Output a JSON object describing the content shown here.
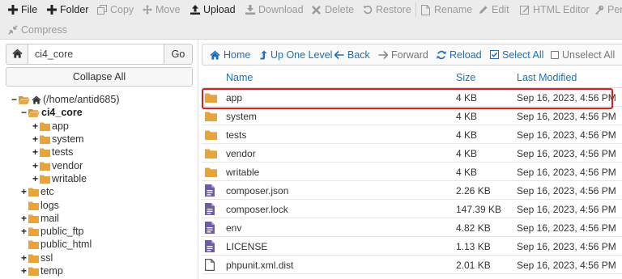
{
  "toolbar": {
    "row1": [
      {
        "label": "File",
        "icon": "plus-icon",
        "enabled": true
      },
      {
        "label": "Folder",
        "icon": "plus-icon",
        "enabled": true
      },
      {
        "label": "Copy",
        "icon": "copy-icon",
        "enabled": false
      },
      {
        "label": "Move",
        "icon": "move-icon",
        "enabled": false
      },
      {
        "label": "Upload",
        "icon": "upload-icon",
        "enabled": true
      },
      {
        "label": "Download",
        "icon": "download-icon",
        "enabled": false
      },
      {
        "label": "Delete",
        "icon": "delete-icon",
        "enabled": false
      },
      {
        "label": "Restore",
        "icon": "restore-icon",
        "enabled": false
      },
      {
        "label": "Rename",
        "icon": "rename-icon",
        "enabled": false
      },
      {
        "label": "Edit",
        "icon": "pencil-icon",
        "enabled": false
      },
      {
        "label": "HTML Editor",
        "icon": "html-editor-icon",
        "enabled": false
      },
      {
        "label": "Perr",
        "icon": "key-icon",
        "enabled": false
      }
    ],
    "compress_label": "Compress"
  },
  "left_panel": {
    "path_value": "ci4_core",
    "go_label": "Go",
    "collapse_label": "Collapse All",
    "tree": [
      {
        "label": "(/home/antid685)",
        "toggle": "−",
        "open": true,
        "home": true,
        "bold": false
      },
      {
        "label": "ci4_core",
        "toggle": "−",
        "open": true,
        "bold": true
      },
      {
        "label": "app",
        "toggle": "+",
        "bold": false
      },
      {
        "label": "system",
        "toggle": "+",
        "bold": false
      },
      {
        "label": "tests",
        "toggle": "+",
        "bold": false
      },
      {
        "label": "vendor",
        "toggle": "+",
        "bold": false
      },
      {
        "label": "writable",
        "toggle": "+",
        "bold": false
      },
      {
        "label": "etc",
        "toggle": "+",
        "bold": false
      },
      {
        "label": "logs",
        "toggle": "",
        "bold": false
      },
      {
        "label": "mail",
        "toggle": "+",
        "bold": false
      },
      {
        "label": "public_ftp",
        "toggle": "+",
        "bold": false
      },
      {
        "label": "public_html",
        "toggle": "",
        "bold": false
      },
      {
        "label": "ssl",
        "toggle": "+",
        "bold": false
      },
      {
        "label": "temp",
        "toggle": "+",
        "bold": false
      }
    ]
  },
  "nav": {
    "home": "Home",
    "up": "Up One Level",
    "back": "Back",
    "forward": "Forward",
    "reload": "Reload",
    "select_all": "Select All",
    "unselect_all": "Unselect All"
  },
  "table": {
    "headers": {
      "name": "Name",
      "size": "Size",
      "modified": "Last Modified"
    },
    "rows": [
      {
        "name": "app",
        "size": "4 KB",
        "modified": "Sep 16, 2023, 4:56 PM",
        "type": "folder",
        "highlighted": true
      },
      {
        "name": "system",
        "size": "4 KB",
        "modified": "Sep 16, 2023, 4:56 PM",
        "type": "folder"
      },
      {
        "name": "tests",
        "size": "4 KB",
        "modified": "Sep 16, 2023, 4:56 PM",
        "type": "folder"
      },
      {
        "name": "vendor",
        "size": "4 KB",
        "modified": "Sep 16, 2023, 4:56 PM",
        "type": "folder"
      },
      {
        "name": "writable",
        "size": "4 KB",
        "modified": "Sep 16, 2023, 4:56 PM",
        "type": "folder"
      },
      {
        "name": "composer.json",
        "size": "2.26 KB",
        "modified": "Sep 16, 2023, 4:56 PM",
        "type": "file"
      },
      {
        "name": "composer.lock",
        "size": "147.39 KB",
        "modified": "Sep 16, 2023, 4:56 PM",
        "type": "file"
      },
      {
        "name": "env",
        "size": "4.82 KB",
        "modified": "Sep 16, 2023, 4:56 PM",
        "type": "file"
      },
      {
        "name": "LICENSE",
        "size": "1.13 KB",
        "modified": "Sep 16, 2023, 4:56 PM",
        "type": "file"
      },
      {
        "name": "phpunit.xml.dist",
        "size": "2.01 KB",
        "modified": "Sep 16, 2023, 4:56 PM",
        "type": "blank-file"
      }
    ]
  },
  "colors": {
    "accent": "#1e6fb8",
    "folder": "#e8a33a",
    "file_purple": "#6f5aa8",
    "highlight_border": "#e01b1b",
    "toolbar_bg": "#ececec"
  }
}
